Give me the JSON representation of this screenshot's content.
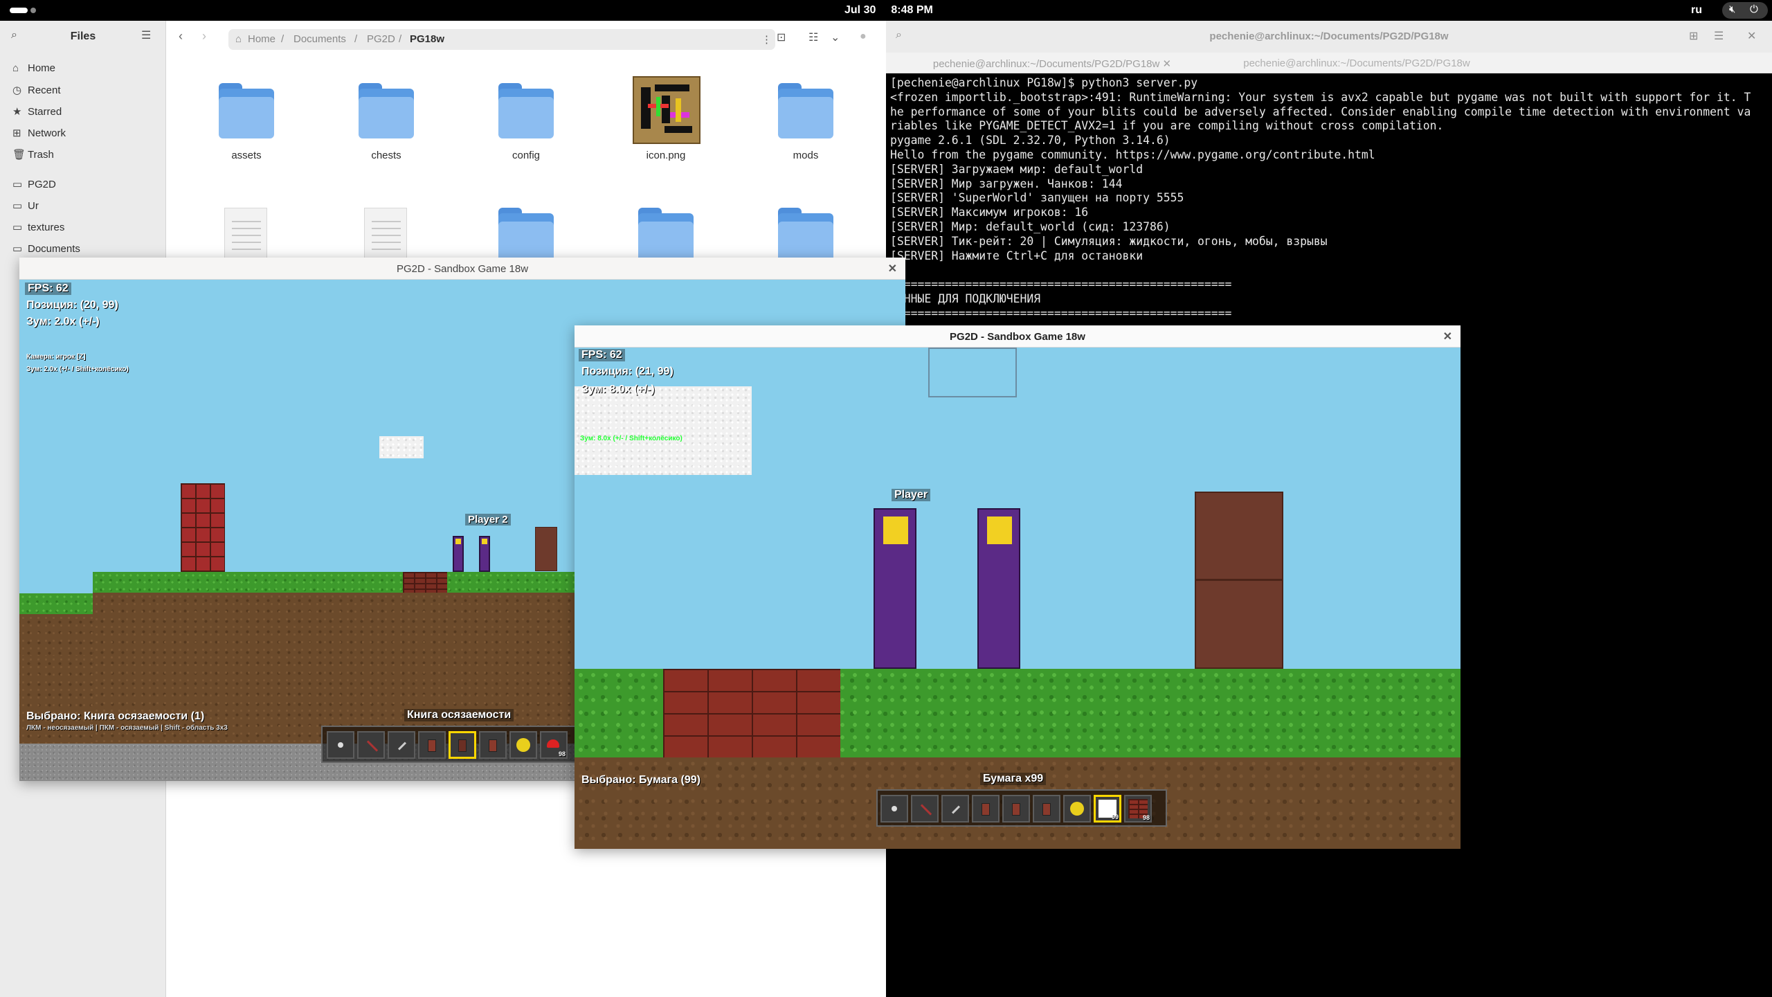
{
  "topbar": {
    "date": "Jul 30",
    "time": "8:48 PM",
    "keyboard": "ru"
  },
  "files": {
    "title": "Files",
    "sidebar": [
      "Home",
      "Recent",
      "Starred",
      "Network",
      "Trash",
      "PG2D",
      "Ur",
      "textures",
      "Documents"
    ],
    "path": [
      "Home",
      "Documents",
      "PG2D",
      "PG18w"
    ],
    "items": [
      {
        "name": "assets",
        "kind": "folder"
      },
      {
        "name": "chests",
        "kind": "folder"
      },
      {
        "name": "config",
        "kind": "folder"
      },
      {
        "name": "icon.png",
        "kind": "image"
      },
      {
        "name": "mods",
        "kind": "folder"
      },
      {
        "name": "",
        "kind": "document"
      },
      {
        "name": "",
        "kind": "document"
      },
      {
        "name": "",
        "kind": "folder"
      },
      {
        "name": "",
        "kind": "folder"
      },
      {
        "name": "",
        "kind": "folder"
      }
    ]
  },
  "terminal": {
    "title": "pechenie@archlinux:~/Documents/PG2D/PG18w",
    "tabs": [
      "pechenie@archlinux:~/Documents/PG2D/PG18w",
      "pechenie@archlinux:~/Documents/PG2D/PG18w"
    ],
    "lines": [
      "[pechenie@archlinux PG18w]$ python3 server.py",
      "<frozen importlib._bootstrap>:491: RuntimeWarning: Your system is avx2 capable but pygame was not built with support for it. T",
      "he performance of some of your blits could be adversely affected. Consider enabling compile time detection with environment va",
      "riables like PYGAME_DETECT_AVX2=1 if you are compiling without cross compilation.",
      "pygame 2.6.1 (SDL 2.32.70, Python 3.14.6)",
      "Hello from the pygame community. https://www.pygame.org/contribute.html",
      "[SERVER] Загружаем мир: default_world",
      "[SERVER] Мир загружен. Чанков: 144",
      "[SERVER] 'SuperWorld' запущен на порту 5555",
      "[SERVER] Максимум игроков: 16",
      "[SERVER] Мир: default_world (сид: 123786)",
      "[SERVER] Тик-рейт: 20 | Симуляция: жидкости, огонь, мобы, взрывы",
      "[SERVER] Нажмите Ctrl+C для остановки",
      "",
      "==================================================",
      "ДАННЫЕ ДЛЯ ПОДКЛЮЧЕНИЯ",
      "=================================================="
    ]
  },
  "game_back": {
    "title": "PG2D - Sandbox Game 18w",
    "fps": "FPS: 62",
    "position": "Позиция: (20, 99)",
    "zoom": "Зум: 2.0x (+/-)",
    "camera": "Камера: игрок [Z]",
    "zoom_hint": "Зум: 2.0x (+/- / Shift+колёсико)",
    "player_label": "Player 2",
    "selected": "Выбрано: Книга осязаемости (1)",
    "controls": "ЛКМ - неосязаемый | ПКМ - осязаемый | Shift - область 3x3",
    "item_title": "Книга осязаемости",
    "slots": [
      "shovel",
      "pickaxe",
      "sword",
      "door",
      "book",
      "door",
      "sun",
      "mushroom"
    ],
    "selected_slot": 4,
    "last_count": "98"
  },
  "game_front": {
    "title": "PG2D - Sandbox Game 18w",
    "fps": "FPS: 62",
    "position": "Позиция: (21, 99)",
    "zoom": "Зум: 8.0x (+/-)",
    "zoom_hint": "Зум: 8.0x (+/- / Shift+колёсико)",
    "player_label": "Player",
    "selected": "Выбрано: Бумага (99)",
    "item_title": "Бумага x99",
    "slots": [
      "shovel",
      "pickaxe",
      "sword",
      "door",
      "door",
      "door",
      "sun",
      "paper",
      "brick"
    ],
    "selected_slot": 7,
    "counts": [
      "",
      "",
      "",
      "",
      "",
      "",
      "",
      "99",
      "98"
    ]
  }
}
